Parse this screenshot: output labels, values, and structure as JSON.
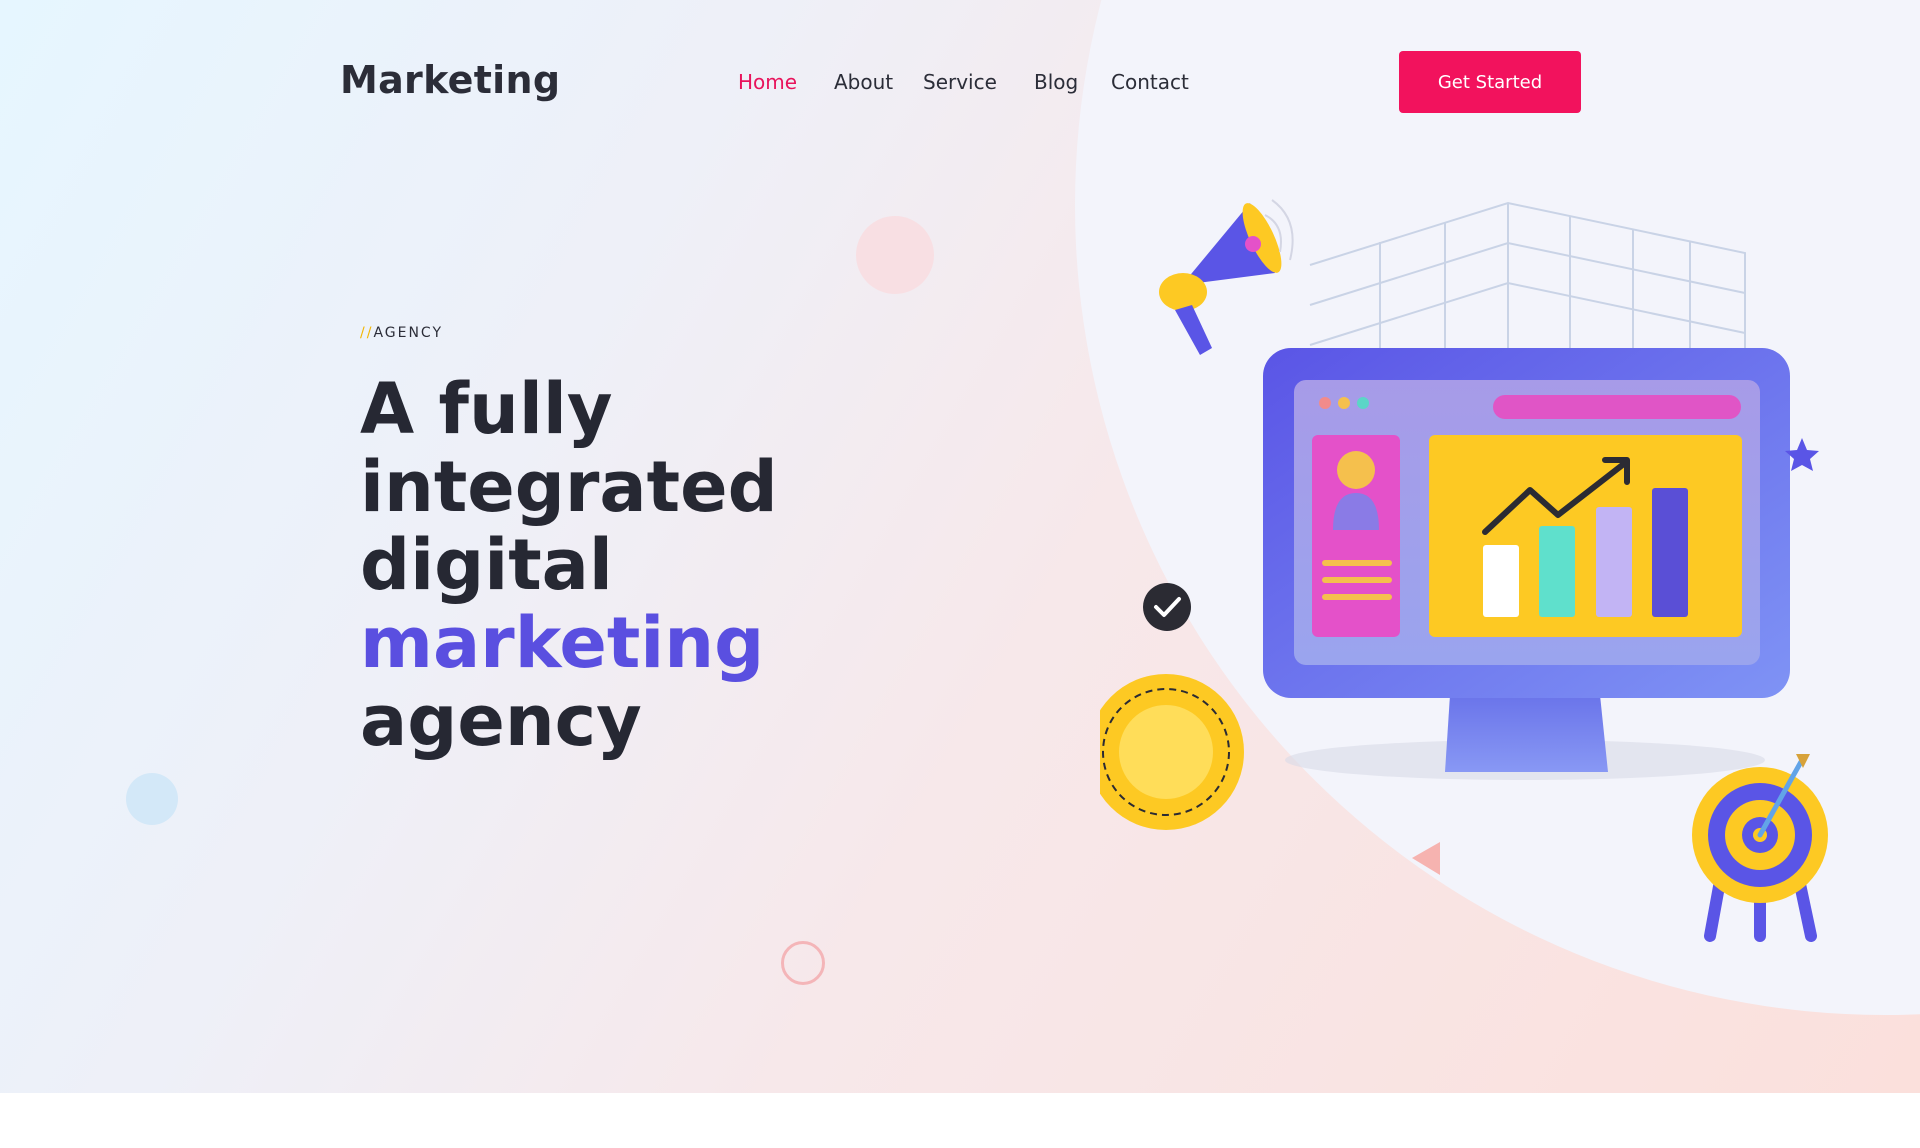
{
  "header": {
    "logo": "Marketing",
    "nav": [
      {
        "label": "Home",
        "active": true
      },
      {
        "label": "About",
        "active": false
      },
      {
        "label": "Service",
        "active": false
      },
      {
        "label": "Blog",
        "active": false
      },
      {
        "label": "Contact",
        "active": false
      }
    ],
    "cta_label": "Get Started"
  },
  "hero": {
    "eyebrow_prefix": "//",
    "eyebrow": "AGENCY",
    "headline_part1": "A fully integrated digital",
    "headline_accent": "marketing",
    "headline_part2": "agency"
  },
  "colors": {
    "accent_pink": "#f2125d",
    "accent_purple": "#5a4fe0",
    "accent_yellow": "#fdc923",
    "text_dark": "#262833"
  },
  "illustration": {
    "icons": [
      "megaphone-icon",
      "monitor-icon",
      "user-avatar-icon",
      "trend-arrow-icon",
      "bar-chart-icon",
      "verified-badge-icon",
      "star-icon",
      "target-icon",
      "arrow-dart-icon"
    ]
  }
}
